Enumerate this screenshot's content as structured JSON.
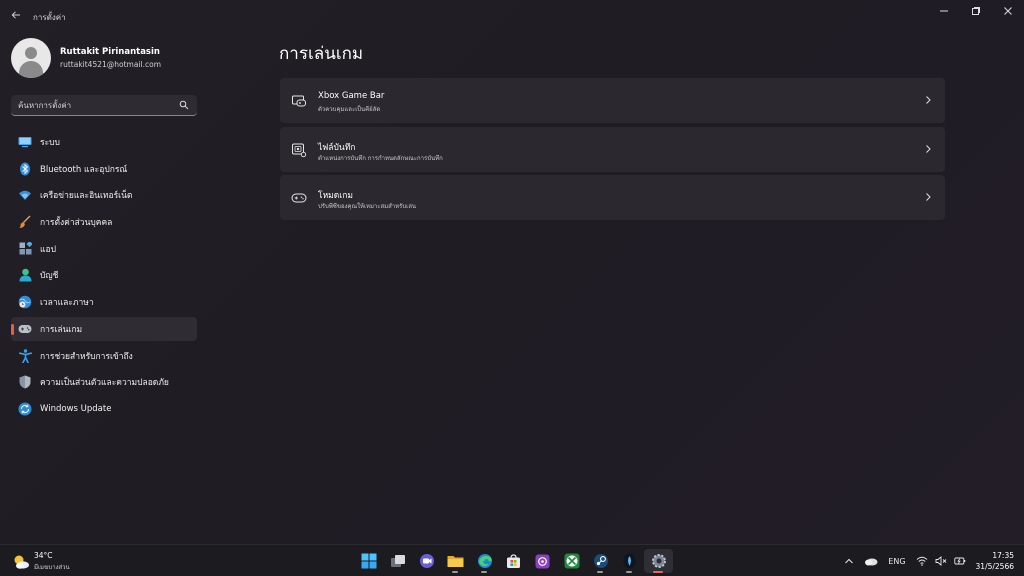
{
  "window": {
    "title": "การตั้งค่า",
    "back_icon": "arrow-left-icon",
    "controls": [
      "minimize",
      "maximize",
      "close"
    ]
  },
  "profile": {
    "name": "Ruttakit Pirinantasin",
    "email": "ruttakit4521@hotmail.com"
  },
  "search": {
    "placeholder": "ค้นหาการตั้งค่า"
  },
  "sidebar": {
    "items": [
      {
        "label": "ระบบ",
        "icon": "monitor-icon"
      },
      {
        "label": "Bluetooth และอุปกรณ์",
        "icon": "bluetooth-icon"
      },
      {
        "label": "เครือข่ายและอินเทอร์เน็ต",
        "icon": "wifi-icon"
      },
      {
        "label": "การตั้งค่าส่วนบุคคล",
        "icon": "brush-icon"
      },
      {
        "label": "แอป",
        "icon": "apps-icon"
      },
      {
        "label": "บัญชี",
        "icon": "account-icon"
      },
      {
        "label": "เวลาและภาษา",
        "icon": "globe-clock-icon"
      },
      {
        "label": "การเล่นเกม",
        "icon": "gamepad-icon",
        "active": true
      },
      {
        "label": "การช่วยสำหรับการเข้าถึง",
        "icon": "accessibility-icon"
      },
      {
        "label": "ความเป็นส่วนตัวและความปลอดภัย",
        "icon": "shield-icon"
      },
      {
        "label": "Windows Update",
        "icon": "update-icon"
      }
    ]
  },
  "main": {
    "title": "การเล่นเกม",
    "cards": [
      {
        "title": "Xbox Game Bar",
        "description": "ตัวควบคุมและเป็นคีย์ลัด",
        "icon": "game-bar-icon"
      },
      {
        "title": "ไฟล์บันทึก",
        "description": "ตำแหน่งการบันทึก การกำหนดลักษณะการบันทึก",
        "icon": "capture-icon"
      },
      {
        "title": "โหมดเกม",
        "description": "ปรับพีซีของคุณให้เหมาะสมสำหรับเล่น",
        "icon": "game-mode-icon"
      }
    ]
  },
  "taskbar": {
    "weather": {
      "temp": "34°C",
      "desc": "มีเมฆบางส่วน"
    },
    "apps": [
      "windows-start",
      "task-view",
      "teams",
      "file-explorer",
      "edge",
      "store",
      "app-purple",
      "xbox",
      "steam",
      "app-dark",
      "settings"
    ],
    "tray": {
      "chevron": "^",
      "language": "ENG",
      "time": "17:35",
      "date": "31/5/2566"
    }
  },
  "colors": {
    "accent": "#e0604a",
    "card_bg": "#2b2830",
    "background": "#221e26"
  }
}
